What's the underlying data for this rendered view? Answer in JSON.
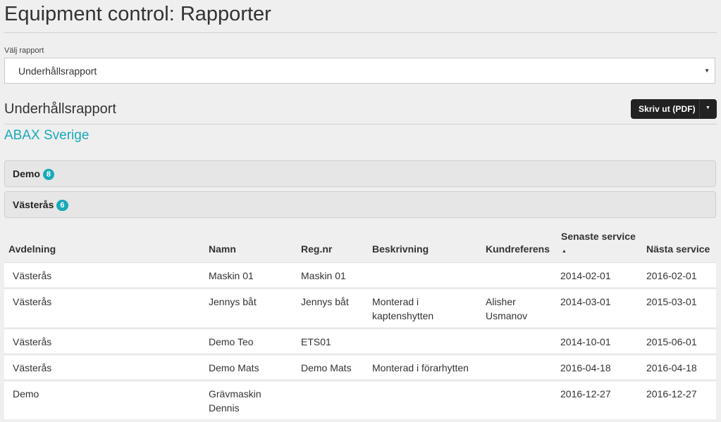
{
  "header": {
    "title": "Equipment control: Rapporter"
  },
  "report_select": {
    "label": "Välj rapport",
    "value": "Underhållsrapport"
  },
  "section": {
    "title": "Underhållsrapport",
    "print_button_label": "Skriv ut (PDF)"
  },
  "company": {
    "name": "ABAX Sverige"
  },
  "groups": [
    {
      "name": "Demo",
      "count": "8"
    },
    {
      "name": "Västerås",
      "count": "6"
    }
  ],
  "table": {
    "columns": {
      "avdelning": "Avdelning",
      "namn": "Namn",
      "regnr": "Reg.nr",
      "beskrivning": "Beskrivning",
      "kundreferens": "Kundreferens",
      "senaste": "Senaste service",
      "nasta": "Nästa service"
    },
    "rows": [
      {
        "avdelning": "Västerås",
        "namn": "Maskin 01",
        "regnr": "Maskin 01",
        "beskrivning": "",
        "kundreferens": "",
        "senaste": "2014-02-01",
        "nasta": "2016-02-01"
      },
      {
        "avdelning": "Västerås",
        "namn": "Jennys båt",
        "regnr": "Jennys båt",
        "beskrivning": "Monterad i kaptenshytten",
        "kundreferens": "Alisher Usmanov",
        "senaste": "2014-03-01",
        "nasta": "2015-03-01"
      },
      {
        "avdelning": "Västerås",
        "namn": "Demo Teo",
        "regnr": "ETS01",
        "beskrivning": "",
        "kundreferens": "",
        "senaste": "2014-10-01",
        "nasta": "2015-06-01"
      },
      {
        "avdelning": "Västerås",
        "namn": "Demo Mats",
        "regnr": "Demo Mats",
        "beskrivning": "Monterad i förarhytten",
        "kundreferens": "",
        "senaste": "2016-04-18",
        "nasta": "2016-04-18"
      },
      {
        "avdelning": "Demo",
        "namn": "Grävmaskin Dennis",
        "regnr": "",
        "beskrivning": "",
        "kundreferens": "",
        "senaste": "2016-12-27",
        "nasta": "2016-12-27"
      }
    ]
  },
  "colors": {
    "accent": "#1aa9b8",
    "button": "#222222"
  }
}
